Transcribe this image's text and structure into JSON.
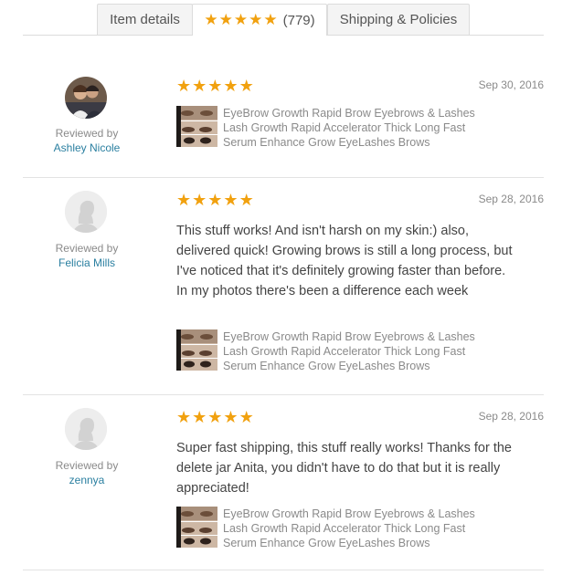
{
  "tabs": {
    "item_details": "Item details",
    "reviews_count": "(779)",
    "shipping": "Shipping & Policies"
  },
  "colors": {
    "star": "#f1a10f",
    "link": "#2a7fa0",
    "muted": "#8a8a8a"
  },
  "reviews": [
    {
      "rating": 5,
      "date": "Sep 30, 2016",
      "reviewed_by": "Reviewed by",
      "reviewer": "Ashley Nicole",
      "avatar": "photo",
      "text": "",
      "product_title": "EyeBrow Growth Rapid Brow Eyebrows & Lashes Lash Growth Rapid Accelerator Thick Long Fast Serum Enhance Grow EyeLashes Brows"
    },
    {
      "rating": 5,
      "date": "Sep 28, 2016",
      "reviewed_by": "Reviewed by",
      "reviewer": "Felicia Mills",
      "avatar": "placeholder",
      "text": "This stuff works! And isn't harsh on my skin:) also, delivered quick! Growing brows is still a long process, but I've noticed that it's definitely growing faster than before. In my photos there's been a difference each week",
      "product_title": "EyeBrow Growth Rapid Brow Eyebrows & Lashes Lash Growth Rapid Accelerator Thick Long Fast Serum Enhance Grow EyeLashes Brows"
    },
    {
      "rating": 5,
      "date": "Sep 28, 2016",
      "reviewed_by": "Reviewed by",
      "reviewer": "zennya",
      "avatar": "placeholder",
      "text": "Super fast shipping, this stuff really works! Thanks for the delete jar Anita, you didn't have to do that but it is really appreciated!",
      "product_title": "EyeBrow Growth Rapid Brow Eyebrows & Lashes Lash Growth Rapid Accelerator Thick Long Fast Serum Enhance Grow EyeLashes Brows"
    }
  ]
}
